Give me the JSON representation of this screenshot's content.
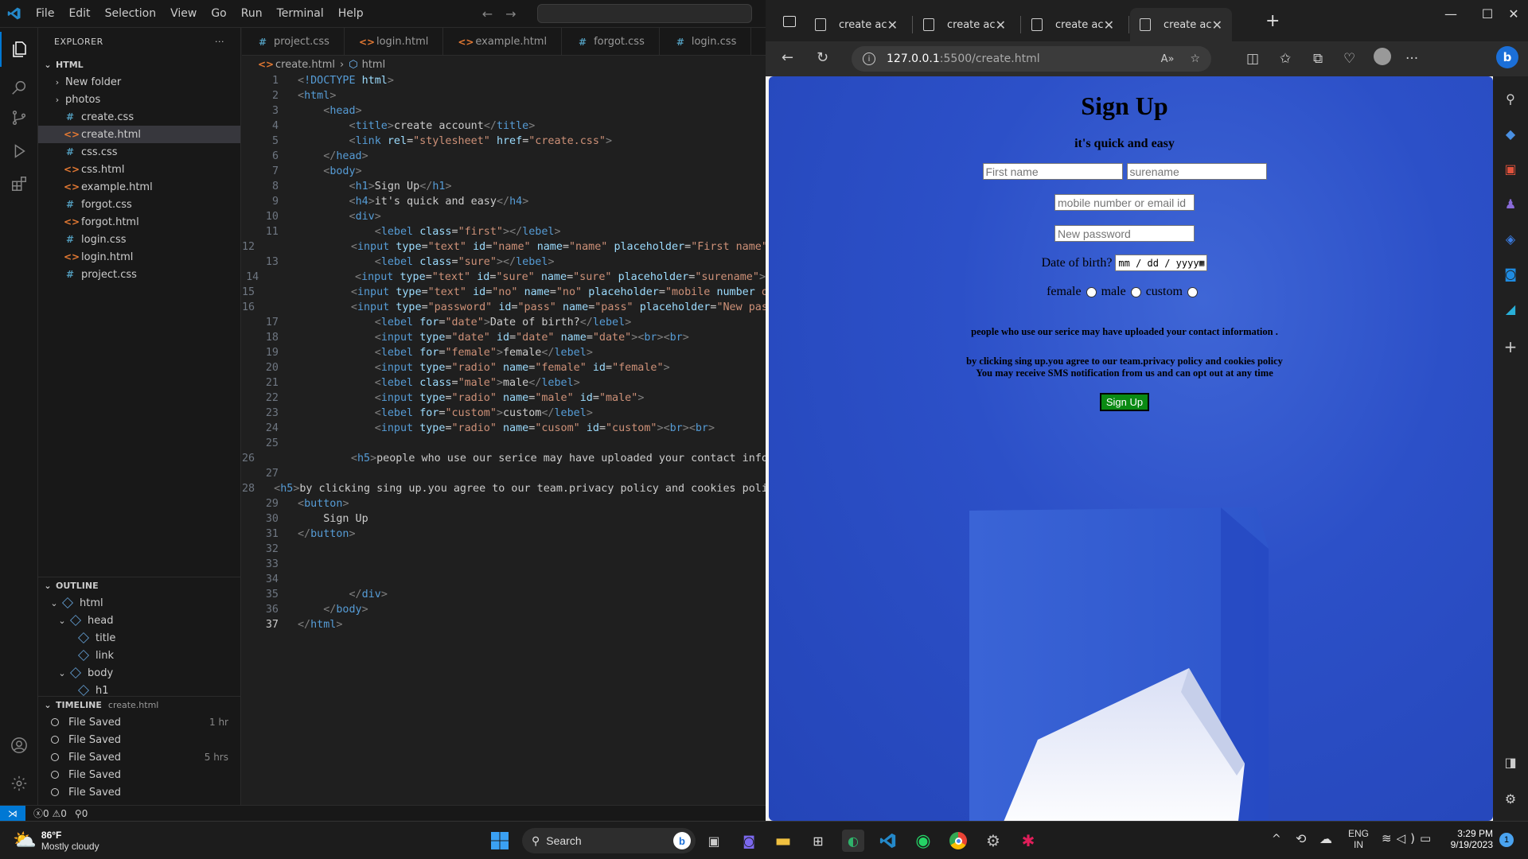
{
  "vscode": {
    "menu": [
      "File",
      "Edit",
      "Selection",
      "View",
      "Go",
      "Run",
      "Terminal",
      "Help"
    ],
    "explorer": {
      "title": "EXPLORER",
      "folder": "HTML",
      "items": [
        {
          "name": "New folder",
          "type": "folder"
        },
        {
          "name": "photos",
          "type": "folder"
        },
        {
          "name": "create.css",
          "type": "css"
        },
        {
          "name": "create.html",
          "type": "html",
          "selected": true
        },
        {
          "name": "css.css",
          "type": "css"
        },
        {
          "name": "css.html",
          "type": "html"
        },
        {
          "name": "example.html",
          "type": "html"
        },
        {
          "name": "forgot.css",
          "type": "css"
        },
        {
          "name": "forgot.html",
          "type": "html"
        },
        {
          "name": "login.css",
          "type": "css"
        },
        {
          "name": "login.html",
          "type": "html"
        },
        {
          "name": "project.css",
          "type": "css"
        }
      ]
    },
    "outline": {
      "title": "OUTLINE",
      "items": [
        {
          "label": "html",
          "depth": 0
        },
        {
          "label": "head",
          "depth": 1
        },
        {
          "label": "title",
          "depth": 2
        },
        {
          "label": "link",
          "depth": 2
        },
        {
          "label": "body",
          "depth": 1
        },
        {
          "label": "h1",
          "depth": 2
        }
      ]
    },
    "timeline": {
      "title": "TIMELINE",
      "file": "create.html",
      "items": [
        {
          "label": "File Saved",
          "time": "1 hr"
        },
        {
          "label": "File Saved",
          "time": ""
        },
        {
          "label": "File Saved",
          "time": "5 hrs"
        },
        {
          "label": "File Saved",
          "time": ""
        },
        {
          "label": "File Saved",
          "time": ""
        },
        {
          "label": "File Saved",
          "time": ""
        }
      ]
    },
    "tabs": [
      {
        "name": "project.css",
        "type": "css"
      },
      {
        "name": "login.html",
        "type": "html"
      },
      {
        "name": "example.html",
        "type": "html"
      },
      {
        "name": "forgot.css",
        "type": "css"
      },
      {
        "name": "login.css",
        "type": "css"
      },
      {
        "name": "c",
        "type": "html"
      }
    ],
    "breadcrumb": [
      "create.html",
      "html"
    ],
    "code": [
      "<!DOCTYPE html>",
      "<html>",
      "    <head>",
      "        <title>create account</title>",
      "        <link rel=\"stylesheet\" href=\"create.css\">",
      "    </head>",
      "    <body>",
      "        <h1>Sign Up</h1>",
      "        <h4>it's quick and easy</h4>",
      "        <div>",
      "            <lebel class=\"first\"></lebel>",
      "            <input type=\"text\" id=\"name\" name=\"name\" placeholder=\"First name\"",
      "            <lebel class=\"sure\"></lebel>",
      "            <input type=\"text\" id=\"sure\" name=\"sure\" placeholder=\"surename\">",
      "            <input type=\"text\" id=\"no\" name=\"no\" placeholder=\"mobile number o",
      "            <input type=\"password\" id=\"pass\" name=\"pass\" placeholder=\"New pas",
      "            <lebel for=\"date\">Date of birth?</lebel>",
      "            <input type=\"date\" id=\"date\" name=\"date\"><br><br>",
      "            <lebel for=\"female\">female</lebel>",
      "            <input type=\"radio\" name=\"female\" id=\"female\">",
      "            <lebel class=\"male\">male</lebel>",
      "            <input type=\"radio\" name=\"male\" id=\"male\">",
      "            <lebel for=\"custom\">custom</lebel>",
      "            <input type=\"radio\" name=\"cusom\" id=\"custom\"><br><br>",
      "",
      "            <h5>people who use our serice may have uploaded your contact info",
      "",
      "<h5>by clicking sing up.you agree to our team.privacy policy and cookies poli",
      "<button>",
      "    Sign Up",
      "</button>",
      "",
      "",
      "",
      "        </div>",
      "    </body>",
      "</html>"
    ],
    "current_line": 37,
    "status": {
      "errors": "0",
      "warnings": "0",
      "ports": "0"
    }
  },
  "edge": {
    "tabs": [
      "create accour",
      "create accour",
      "create accour",
      "create accour"
    ],
    "url_host": "127.0.0.1",
    "url_path": ":5500/create.html",
    "page": {
      "title": "Sign Up",
      "subtitle": "it's quick and easy",
      "first_name_ph": "First name",
      "surename_ph": "surename",
      "mobile_ph": "mobile number or email id",
      "password_ph": "New password",
      "dob_label": "Date of birth?",
      "date_value": "mm / dd / yyyy",
      "female": "female",
      "male": "male",
      "custom": "custom",
      "contact_notice": "people who use our serice may have uploaded your contact information .",
      "agree_line1": "by clicking sing up.you agree to our team.privacy policy and cookies policy",
      "agree_line2": "You may receive SMS notification from us and can opt out at any time",
      "button": "Sign Up"
    }
  },
  "taskbar": {
    "weather_temp": "86°F",
    "weather_desc": "Mostly cloudy",
    "search": "Search",
    "lang1": "ENG",
    "lang2": "IN",
    "time": "3:29 PM",
    "date": "9/19/2023",
    "notif_count": "1"
  },
  "colors": {
    "accent": "#0078d4",
    "page_blue": "#2c50c8",
    "button_green": "#0a8a13"
  }
}
